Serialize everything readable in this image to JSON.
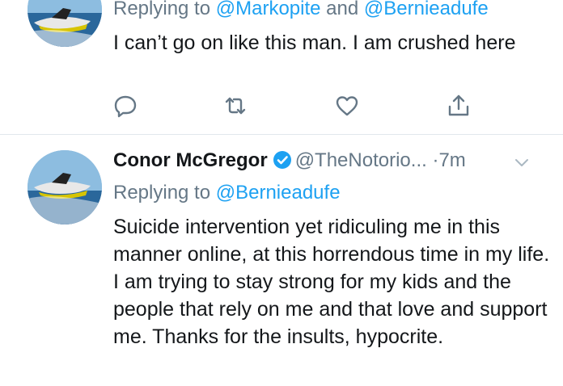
{
  "tweets": [
    {
      "replying_prefix": "Replying to",
      "mention_1": "@Markopite",
      "joiner": "and",
      "mention_2": "@Bernieadufe",
      "text": "I can’t go on like this man. I am crushed here",
      "actions": [
        "reply-icon",
        "retweet-icon",
        "like-icon",
        "share-icon"
      ]
    },
    {
      "display_name": "Conor McGregor",
      "verified": true,
      "handle": "@TheNotorio...",
      "dot": "·",
      "time": "7m",
      "replying_prefix": "Replying to",
      "mention_1": "@Bernieadufe",
      "text": "Suicide intervention yet ridiculing me in this manner online, at this horrendous time in my life. I am trying to stay strong for my kids and the people that rely on me and that love and support me. Thanks for the insults, hypocrite."
    }
  ],
  "colors": {
    "text": "#14171a",
    "secondary": "#657786",
    "link": "#1da1f2",
    "divider": "#e1e8ed",
    "verified": "#1da1f2"
  }
}
